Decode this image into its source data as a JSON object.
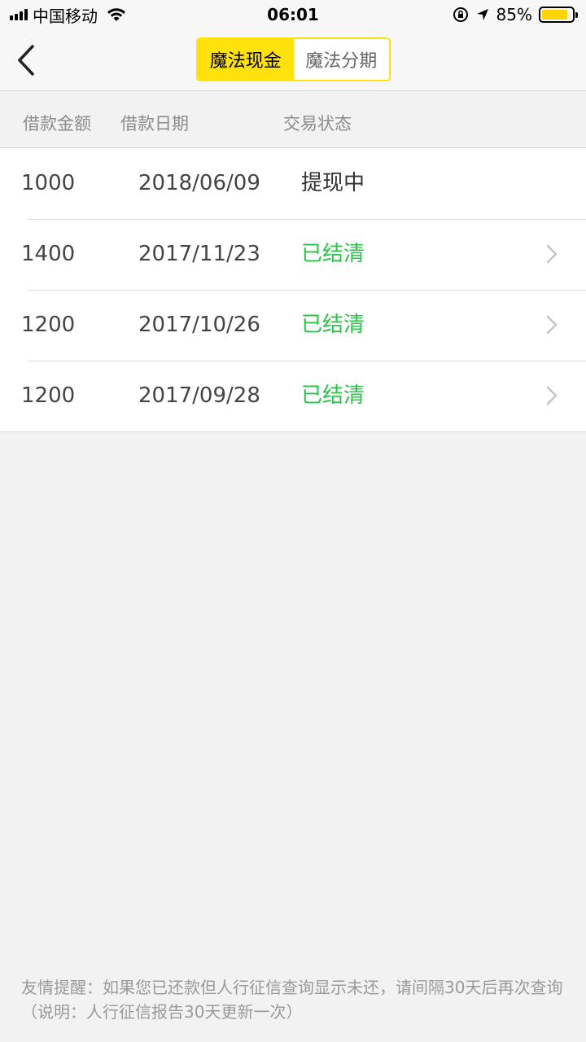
{
  "status_bar": {
    "carrier": "中国移动",
    "time": "06:01",
    "battery_percent": "85%",
    "battery_level": 0.85,
    "battery_color": "#ffd400"
  },
  "nav": {
    "back_icon": "chevron-left-icon",
    "tabs": [
      {
        "label": "魔法现金",
        "active": true
      },
      {
        "label": "魔法分期",
        "active": false
      }
    ],
    "accent_color": "#ffe20c"
  },
  "table": {
    "headers": [
      "借款金额",
      "借款日期",
      "交易状态"
    ],
    "rows": [
      {
        "amount": "1000",
        "date": "2018/06/09",
        "status": "提现中",
        "status_color": "#333333",
        "has_chevron": false
      },
      {
        "amount": "1400",
        "date": "2017/11/23",
        "status": "已结清",
        "status_color": "#2bc34a",
        "has_chevron": true
      },
      {
        "amount": "1200",
        "date": "2017/10/26",
        "status": "已结清",
        "status_color": "#2bc34a",
        "has_chevron": true
      },
      {
        "amount": "1200",
        "date": "2017/09/28",
        "status": "已结清",
        "status_color": "#2bc34a",
        "has_chevron": true
      }
    ]
  },
  "footer": {
    "note": "友情提醒：如果您已还款但人行征信查询显示未还，请间隔30天后再次查询（说明：人行征信报告30天更新一次）"
  }
}
